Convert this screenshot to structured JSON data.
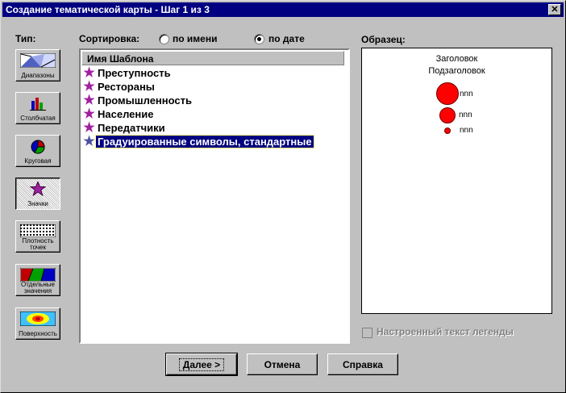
{
  "window": {
    "title": "Создание тематической карты - Шаг 1 из 3",
    "close_glyph": "✕"
  },
  "type_panel": {
    "label": "Тип:",
    "buttons": [
      {
        "caption": "Диапазоны",
        "icon": "ranges-icon",
        "pressed": false
      },
      {
        "caption": "Столбчатая",
        "icon": "bar-chart-icon",
        "pressed": false
      },
      {
        "caption": "Круговая",
        "icon": "pie-chart-icon",
        "pressed": false
      },
      {
        "caption": "Значки",
        "icon": "symbol-star-icon",
        "pressed": true
      },
      {
        "caption1": "Плотность",
        "caption2": "точек",
        "icon": "dot-density-icon",
        "pressed": false
      },
      {
        "caption1": "Отдельные",
        "caption2": "значения",
        "icon": "individual-values-icon",
        "pressed": false
      },
      {
        "caption": "Поверхность",
        "icon": "grid-surface-icon",
        "pressed": false
      }
    ]
  },
  "sort": {
    "label": "Сортировка:",
    "by_name": "по имени",
    "by_date": "по дате",
    "selected": "by_date"
  },
  "template_list": {
    "header": "Имя Шаблона",
    "items": [
      "Преступность",
      "Рестораны",
      "Промышленность",
      "Население",
      "Передатчики",
      "Градуированные символы, стандартные"
    ],
    "selected_index": 5
  },
  "sample": {
    "label": "Образец:",
    "title": "Заголовок",
    "subtitle": "Подзаголовок",
    "legend_text": "nnn",
    "symbol_color": "#ff0000"
  },
  "custom_legend": {
    "label": "Настроенный текст легенды",
    "checked": false,
    "enabled": false
  },
  "buttons": {
    "next": "Далее >",
    "cancel": "Отмена",
    "help": "Справка"
  }
}
